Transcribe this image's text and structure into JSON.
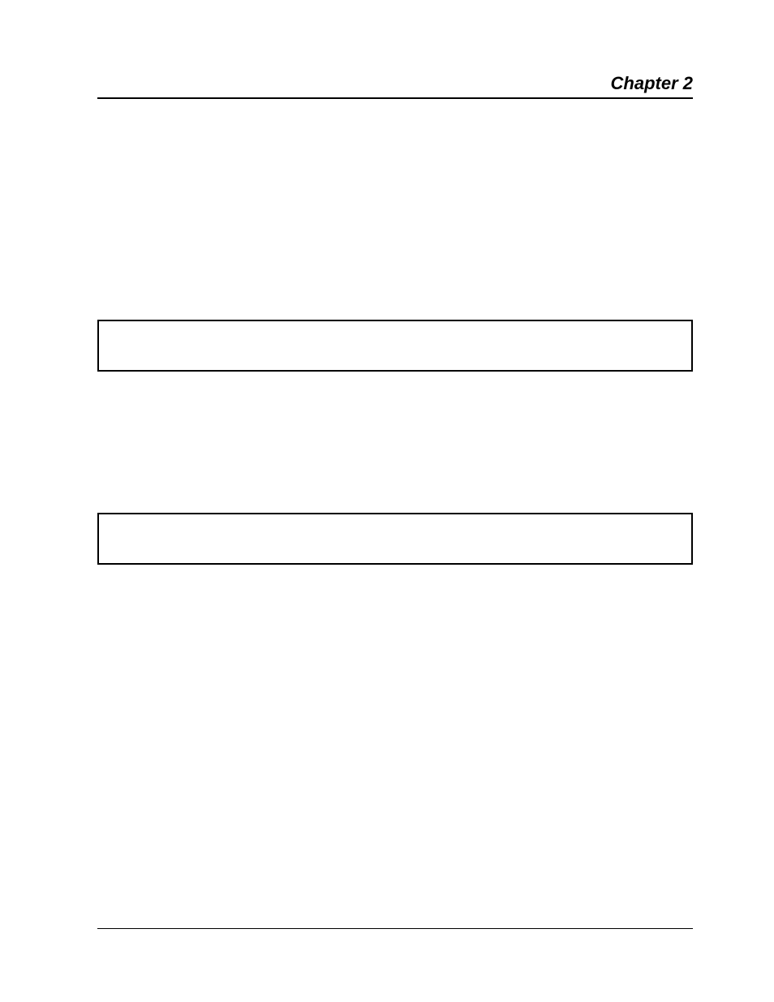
{
  "header": {
    "chapter_label": "Chapter 2"
  }
}
